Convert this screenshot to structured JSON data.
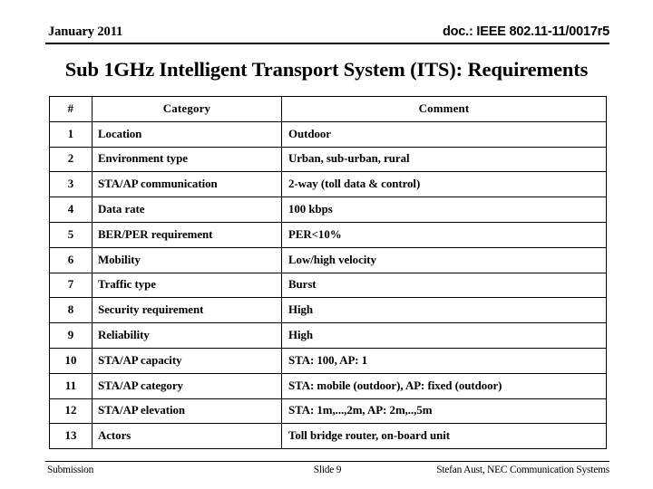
{
  "header": {
    "date": "January 2011",
    "doc_ref": "doc.: IEEE 802.11-11/0017r5"
  },
  "title": "Sub 1GHz Intelligent Transport System (ITS): Requirements",
  "table": {
    "columns": [
      "#",
      "Category",
      "Comment"
    ],
    "rows": [
      {
        "num": "1",
        "category": "Location",
        "comment": "Outdoor"
      },
      {
        "num": "2",
        "category": "Environment type",
        "comment": "Urban, sub-urban, rural"
      },
      {
        "num": "3",
        "category": "STA/AP communication",
        "comment": "2-way (toll data & control)"
      },
      {
        "num": "4",
        "category": "Data rate",
        "comment": "100 kbps"
      },
      {
        "num": "5",
        "category": "BER/PER requirement",
        "comment": "PER<10%"
      },
      {
        "num": "6",
        "category": "Mobility",
        "comment": "Low/high velocity"
      },
      {
        "num": "7",
        "category": "Traffic type",
        "comment": "Burst"
      },
      {
        "num": "8",
        "category": "Security requirement",
        "comment": "High"
      },
      {
        "num": "9",
        "category": "Reliability",
        "comment": "High"
      },
      {
        "num": "10",
        "category": "STA/AP capacity",
        "comment": "STA: 100, AP: 1"
      },
      {
        "num": "11",
        "category": "STA/AP category",
        "comment": "STA: mobile (outdoor), AP: fixed (outdoor)"
      },
      {
        "num": "12",
        "category": "STA/AP elevation",
        "comment": "STA: 1m,...,2m, AP: 2m,..,5m"
      },
      {
        "num": "13",
        "category": "Actors",
        "comment": "Toll bridge router, on-board unit"
      }
    ]
  },
  "footer": {
    "left": "Submission",
    "center": "Slide 9",
    "right": "Stefan Aust, NEC Communication Systems"
  },
  "colors": {
    "text": "#000000",
    "background": "#ffffff",
    "rule": "#000000"
  }
}
